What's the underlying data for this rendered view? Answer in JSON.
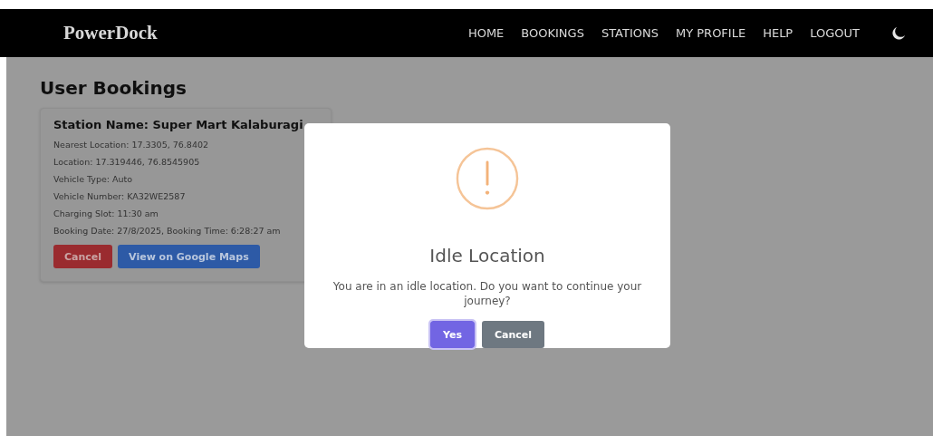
{
  "navbar": {
    "brand": "PowerDock",
    "links": [
      {
        "label": "HOME"
      },
      {
        "label": "BOOKINGS"
      },
      {
        "label": "STATIONS"
      },
      {
        "label": "MY PROFILE"
      },
      {
        "label": "HELP"
      },
      {
        "label": "LOGOUT"
      }
    ]
  },
  "page": {
    "title": "User Bookings",
    "bookings": [
      {
        "station": "Station Name: Super Mart Kalaburagi",
        "details": [
          "Nearest Location: 17.3305, 76.8402",
          "Location: 17.319446, 76.8545905",
          "Vehicle Type: Auto",
          "Vehicle Number: KA32WE2587",
          "Charging Slot: 11:30 am",
          "Booking Date: 27/8/2025, Booking Time: 6:28:27 am"
        ],
        "cancel_label": "Cancel",
        "map_label": "View on Google Maps"
      }
    ]
  },
  "dialog": {
    "title": "Idle Location",
    "message": "You are in an idle location. Do you want to continue your journey?",
    "confirm_label": "Yes",
    "cancel_label": "Cancel"
  }
}
